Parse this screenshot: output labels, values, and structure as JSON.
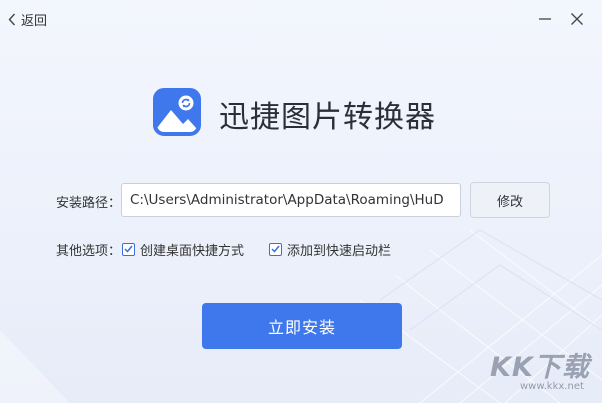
{
  "titlebar": {
    "back_label": "返回",
    "back_icon": "chevron-left-icon",
    "minimize_icon": "minimize-icon",
    "close_icon": "close-icon"
  },
  "app": {
    "title": "迅捷图片转换器",
    "logo_icon": "image-convert-logo-icon",
    "brand_color": "#3f78ec"
  },
  "install_path": {
    "label": "安装路径：",
    "value": "C:\\Users\\Administrator\\AppData\\Roaming\\HuD",
    "modify_label": "修改"
  },
  "options": {
    "label": "其他选项：",
    "items": [
      {
        "label": "创建桌面快捷方式",
        "checked": true
      },
      {
        "label": "添加到快速启动栏",
        "checked": true
      }
    ]
  },
  "install_button": {
    "label": "立即安装"
  },
  "watermark": {
    "text": "KK下载",
    "url": "www.kkx.net"
  }
}
